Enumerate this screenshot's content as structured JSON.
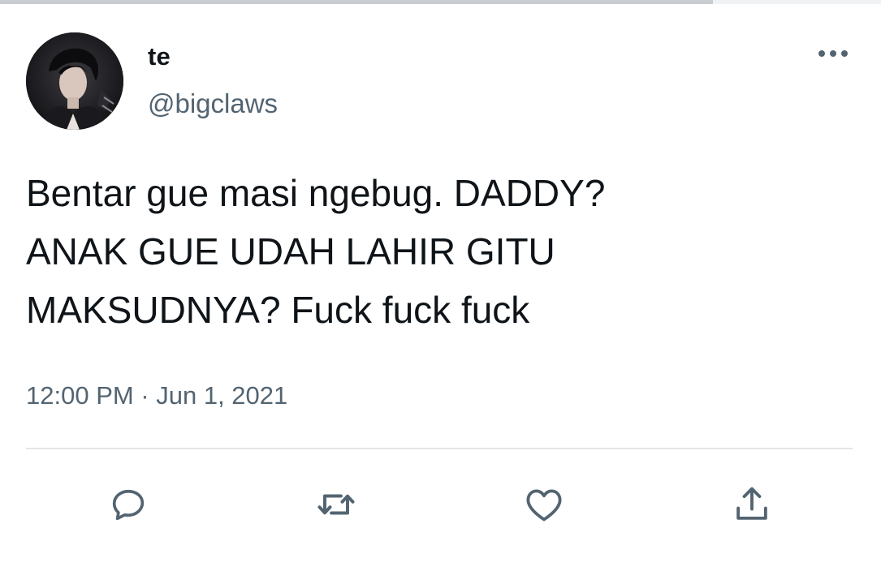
{
  "tweet": {
    "author": {
      "display_name": "te",
      "handle": "@bigclaws",
      "avatar_icon": "profile-photo"
    },
    "text": "Bentar gue masi ngebug. DADDY?\nANAK GUE UDAH LAHIR GITU\nMAKSUDNYA? Fuck fuck fuck",
    "timestamp": "12:00 PM · Jun 1, 2021",
    "more_icon": "more-horizontal-icon",
    "actions": [
      {
        "name": "reply",
        "icon": "reply-icon"
      },
      {
        "name": "retweet",
        "icon": "retweet-icon"
      },
      {
        "name": "like",
        "icon": "heart-icon"
      },
      {
        "name": "share",
        "icon": "share-icon"
      }
    ]
  },
  "colors": {
    "text_primary": "#0f1419",
    "text_secondary": "#536471",
    "divider": "#e3e6e9",
    "icon": "#536471"
  }
}
